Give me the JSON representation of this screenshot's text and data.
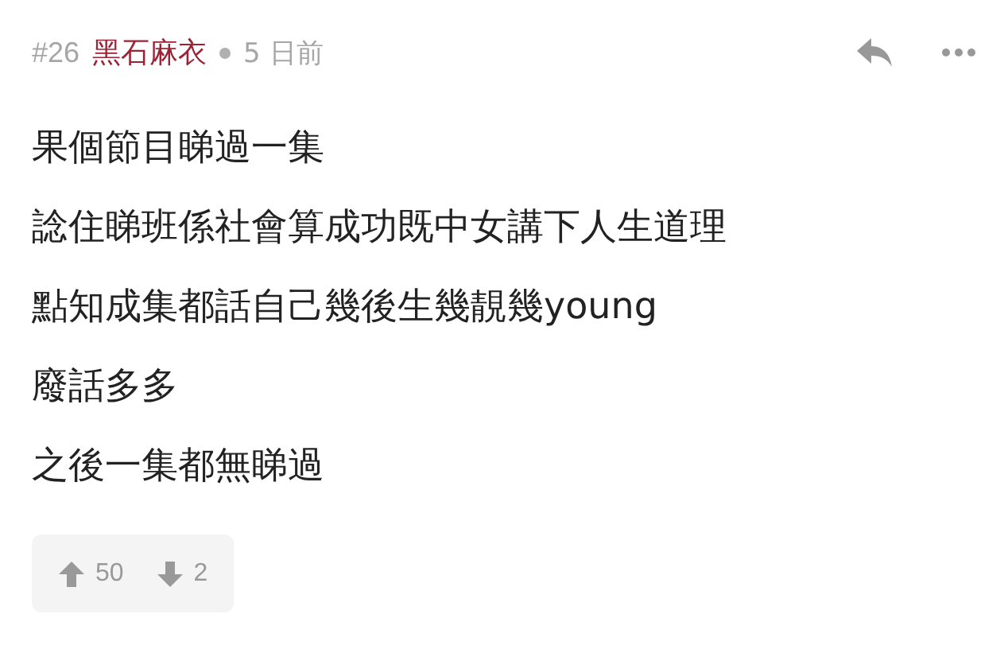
{
  "post": {
    "number": "#26",
    "author": "黑石麻衣",
    "time": "5 日前"
  },
  "lines": [
    "果個節目睇過一集",
    "諗住睇班係社會算成功既中女講下人生道理",
    "點知成集都話自己幾後生幾靚幾young",
    "廢話多多",
    "之後一集都無睇過"
  ],
  "votes": {
    "up": "50",
    "down": "2"
  }
}
